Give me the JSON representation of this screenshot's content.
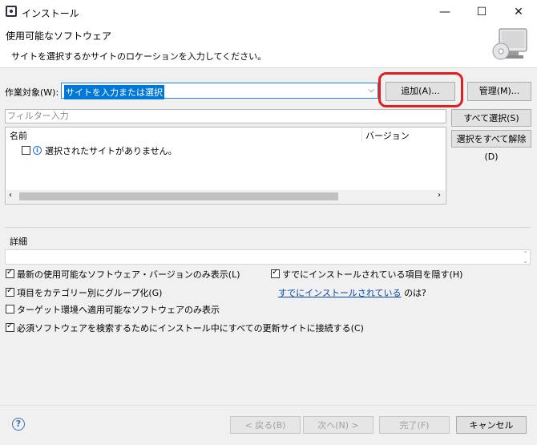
{
  "window": {
    "title": "インストール",
    "minimize": "—",
    "maximize": "☐",
    "close": "✕"
  },
  "header": {
    "title": "使用可能なソフトウェア",
    "description": "サイトを選択するかサイトのロケーションを入力してください。"
  },
  "work_with": {
    "label": "作業対象(W):",
    "value": "サイトを入力または選択",
    "add_button": "追加(A)...",
    "manage_button": "管理(M)..."
  },
  "filter": {
    "placeholder": "フィルター入力"
  },
  "table": {
    "col_name": "名前",
    "col_version": "バージョン",
    "empty_message": "選択されたサイトがありません。"
  },
  "side_buttons": {
    "select_all": "すべて選択(S)",
    "deselect_all": "選択をすべて解除(D)"
  },
  "details": {
    "label": "詳細"
  },
  "options": {
    "latest_only": "最新の使用可能なソフトウェア・バージョンのみ表示(L)",
    "group_by_category": "項目をカテゴリー別にグループ化(G)",
    "target_env_only": "ターゲット環境へ適用可能なソフトウェアのみ表示",
    "contact_all_sites": "必須ソフトウェアを検索するためにインストール中にすべての更新サイトに接続する(C)",
    "hide_installed": "すでにインストールされている項目を隠す(H)",
    "already_installed_link": "すでにインストールされている",
    "already_installed_suffix": "のは?"
  },
  "footer": {
    "help": "?",
    "back": "< 戻る(B)",
    "next": "次へ(N) >",
    "finish": "完了(F)",
    "cancel": "キャンセル"
  }
}
